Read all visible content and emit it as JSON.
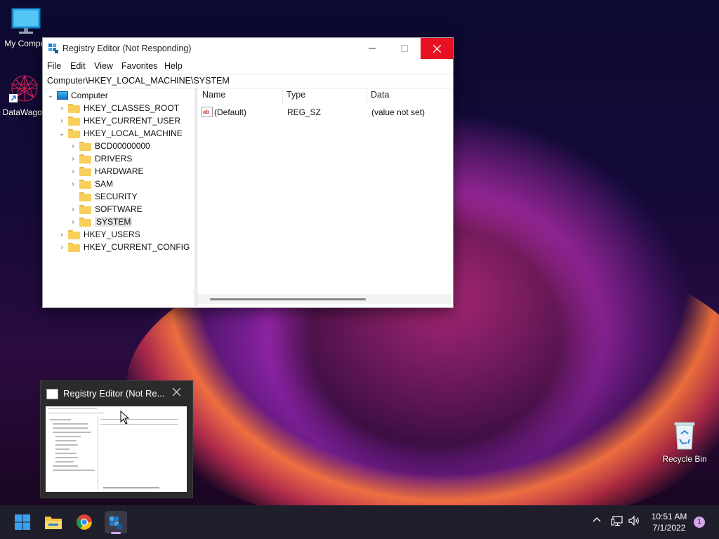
{
  "desktop": {
    "icons": [
      {
        "label": "My Comput"
      },
      {
        "label": "DataWagon"
      },
      {
        "label": "Recycle Bin"
      }
    ]
  },
  "window": {
    "title": "Registry Editor (Not Responding)",
    "menu": [
      "File",
      "Edit",
      "View",
      "Favorites",
      "Help"
    ],
    "address": "Computer\\HKEY_LOCAL_MACHINE\\SYSTEM",
    "tree": [
      {
        "label": "Computer",
        "level": 0,
        "expanded": true
      },
      {
        "label": "HKEY_CLASSES_ROOT",
        "level": 1
      },
      {
        "label": "HKEY_CURRENT_USER",
        "level": 1
      },
      {
        "label": "HKEY_LOCAL_MACHINE",
        "level": 1,
        "expanded": true
      },
      {
        "label": "BCD00000000",
        "level": 2
      },
      {
        "label": "DRIVERS",
        "level": 2
      },
      {
        "label": "HARDWARE",
        "level": 2
      },
      {
        "label": "SAM",
        "level": 2
      },
      {
        "label": "SECURITY",
        "level": 2
      },
      {
        "label": "SOFTWARE",
        "level": 2
      },
      {
        "label": "SYSTEM",
        "level": 2,
        "selected": true
      },
      {
        "label": "HKEY_USERS",
        "level": 1
      },
      {
        "label": "HKEY_CURRENT_CONFIG",
        "level": 1
      }
    ],
    "columns": [
      "Name",
      "Type",
      "Data"
    ],
    "values": [
      {
        "name": "(Default)",
        "type": "REG_SZ",
        "data": "(value not set)"
      }
    ]
  },
  "thumbnail": {
    "title": "Registry Editor (Not Re..."
  },
  "taskbar": {
    "time": "10:51 AM",
    "date": "7/1/2022",
    "notification_count": "1"
  },
  "colors": {
    "close_red": "#e81123",
    "taskbar": "#1f1f2b",
    "folder": "#f8cf5a"
  }
}
